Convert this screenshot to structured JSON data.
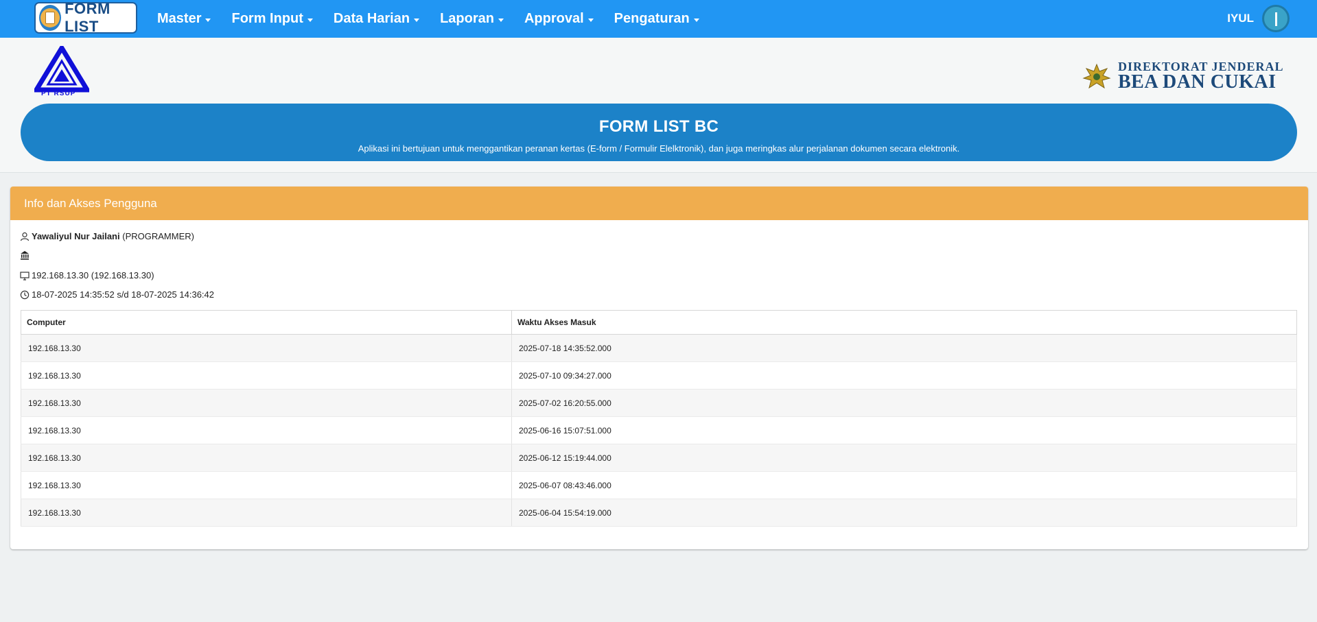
{
  "navbar": {
    "brand": "FORM LIST",
    "menu": [
      {
        "label": "Master"
      },
      {
        "label": "Form Input"
      },
      {
        "label": "Data Harian"
      },
      {
        "label": "Laporan"
      },
      {
        "label": "Approval"
      },
      {
        "label": "Pengaturan"
      }
    ],
    "user": "IYUL"
  },
  "header": {
    "logo_left_text": "PT RSUP",
    "logo_right_line1": "DIREKTORAT JENDERAL",
    "logo_right_line2": "BEA DAN CUKAI",
    "title": "FORM LIST BC",
    "subtitle": "Aplikasi ini bertujuan untuk menggantikan peranan kertas (E-form / Formulir Elelktronik), dan juga meringkas alur perjalanan dokumen secara elektronik."
  },
  "panel": {
    "title": "Info dan Akses Pengguna",
    "user_name": "Yawaliyul Nur Jailani",
    "user_role": "(PROGRAMMER)",
    "computer": "192.168.13.30 (192.168.13.30)",
    "session": "18-07-2025 14:35:52 s/d 18-07-2025 14:36:42"
  },
  "table": {
    "headers": [
      "Computer",
      "Waktu Akses Masuk"
    ],
    "rows": [
      [
        "192.168.13.30",
        "2025-07-18 14:35:52.000"
      ],
      [
        "192.168.13.30",
        "2025-07-10 09:34:27.000"
      ],
      [
        "192.168.13.30",
        "2025-07-02 16:20:55.000"
      ],
      [
        "192.168.13.30",
        "2025-06-16 15:07:51.000"
      ],
      [
        "192.168.13.30",
        "2025-06-12 15:19:44.000"
      ],
      [
        "192.168.13.30",
        "2025-06-07 08:43:46.000"
      ],
      [
        "192.168.13.30",
        "2025-06-04 15:54:19.000"
      ]
    ]
  },
  "colors": {
    "navbar": "#2196f3",
    "hero": "#1c82c8",
    "panel_header": "#f0ad4e"
  }
}
